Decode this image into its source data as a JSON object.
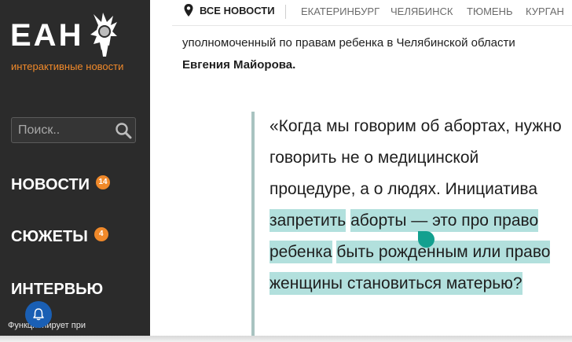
{
  "sidebar": {
    "logo": "ЕАН",
    "tagline": "интерактивные новости",
    "search": {
      "placeholder": "Поиск.."
    },
    "nav": [
      {
        "label": "НОВОСТИ",
        "badge": "14"
      },
      {
        "label": "СЮЖЕТЫ",
        "badge": "4"
      },
      {
        "label": "ИНТЕРВЬЮ"
      }
    ],
    "notification_text": "Функционирует при"
  },
  "topnav": {
    "all_news": "ВСЕ НОВОСТИ",
    "cities": [
      "ЕКАТЕРИНБУРГ",
      "ЧЕЛЯБИНСК",
      "ТЮМЕНЬ",
      "КУРГАН"
    ]
  },
  "article": {
    "intro_text": "уполномоченный по правам ребенка в Челябинской области ",
    "intro_name": "Евгения Майорова.",
    "quote_plain": "«Когда мы говорим об абортах, нужно говорить не о медицинской процедуре, а о людях. Инициатива ",
    "quote_highlight": [
      "запретить",
      "аборты — это про право ребенка",
      "быть рожденным или право",
      "женщины становиться матерью?"
    ]
  },
  "colors": {
    "sidebar_bg": "#2b2b2b",
    "accent_orange": "#f0892a",
    "highlight": "#b2e0dd",
    "selection_handle": "#13a08f",
    "quote_bar": "#a9c3c0",
    "bell_blue": "#1a5fb4"
  }
}
